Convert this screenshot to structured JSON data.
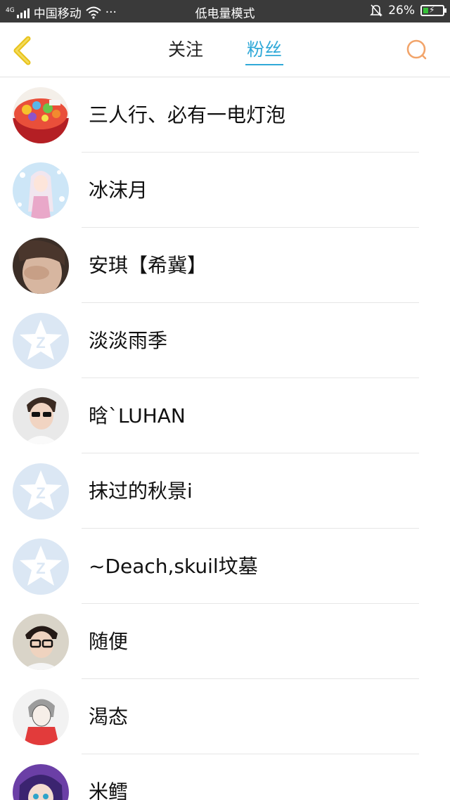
{
  "status_bar": {
    "network": "4G",
    "carrier": "中国移动",
    "more": "···",
    "mode": "低电量模式",
    "battery_percent": "26%",
    "battery_level": 0.26
  },
  "header": {
    "tabs": [
      {
        "label": "关注",
        "active": false
      },
      {
        "label": "粉丝",
        "active": true
      }
    ],
    "accent_color": "#30a9d8",
    "back_icon": "chevron-left-icon",
    "search_icon": "search-icon"
  },
  "fans": [
    {
      "name": "三人行、必有一电灯泡",
      "avatar": "cake-photo"
    },
    {
      "name": "冰沫月",
      "avatar": "anime-girl"
    },
    {
      "name": "安琪【希冀】",
      "avatar": "face-photo"
    },
    {
      "name": "淡淡雨季",
      "avatar": "default-qq-icon"
    },
    {
      "name": "晗`LUHAN",
      "avatar": "boy-sunglasses"
    },
    {
      "name": "抹过的秋景i",
      "avatar": "default-qq-icon"
    },
    {
      "name": "~Deach,skuil坟墓",
      "avatar": "default-qq-icon"
    },
    {
      "name": "随便",
      "avatar": "boy-glasses"
    },
    {
      "name": "渴态",
      "avatar": "sketch-girl-red"
    },
    {
      "name": "米鳕",
      "avatar": "anime-purple"
    }
  ]
}
